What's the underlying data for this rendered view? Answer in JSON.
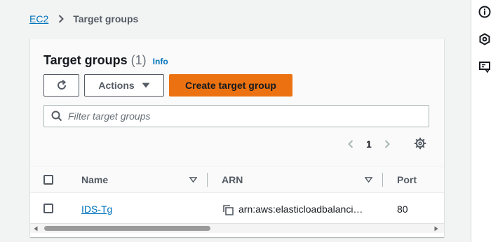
{
  "breadcrumb": {
    "root": "EC2",
    "current": "Target groups"
  },
  "panel": {
    "title": "Target groups",
    "count": "(1)",
    "info": "Info",
    "actions_label": "Actions",
    "create_label": "Create target group",
    "search_placeholder": "Filter target groups",
    "page_number": "1"
  },
  "table": {
    "headers": [
      "Name",
      "ARN",
      "Port"
    ],
    "rows": [
      {
        "name": "IDS-Tg",
        "arn": "arn:aws:elasticloadbalanci…",
        "port": "80"
      }
    ]
  },
  "icons": {
    "rail": [
      "info-icon",
      "settings-hex-icon",
      "feedback-icon"
    ],
    "toolbar": [
      "refresh-icon",
      "caret-down-icon",
      "search-icon"
    ],
    "table": [
      "copy-icon",
      "sort-down-icon"
    ]
  },
  "colors": {
    "primary": "#ec7211",
    "link": "#0073bb",
    "text": "#16191f",
    "background": "#f2f3f3"
  }
}
